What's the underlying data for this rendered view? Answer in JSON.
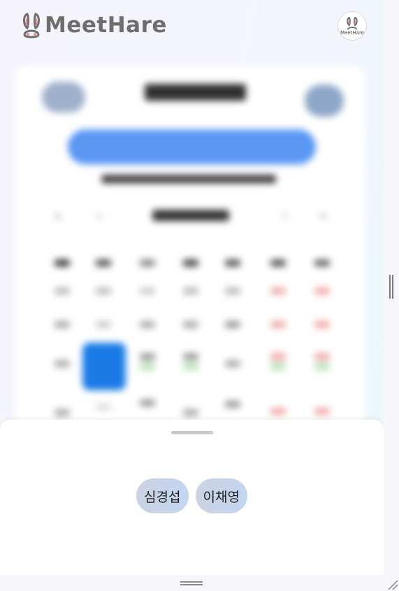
{
  "app": {
    "brand": "MeetHare",
    "avatar_caption": "MeetHare"
  },
  "bottom_sheet": {
    "participants": [
      {
        "name": "심경섭"
      },
      {
        "name": "이채영"
      }
    ]
  },
  "colors": {
    "brand_gray": "#6e6e6e",
    "rabbit_pink": "#e88a9a",
    "primary_blue": "#4d8ff5",
    "chip_bg": "#c8d3ea"
  }
}
